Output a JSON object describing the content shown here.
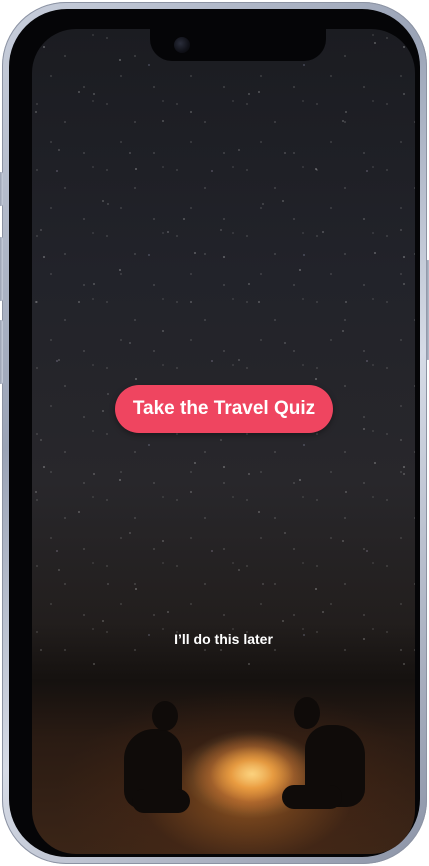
{
  "screen": {
    "primary_button_label": "Take the Travel Quiz",
    "secondary_link_label": "I’ll do this later"
  },
  "colors": {
    "primary_button": "#ef4560",
    "button_text": "#ffffff",
    "link_text": "#ffffff"
  },
  "background": {
    "scene": "night-sky-campfire-photo"
  }
}
